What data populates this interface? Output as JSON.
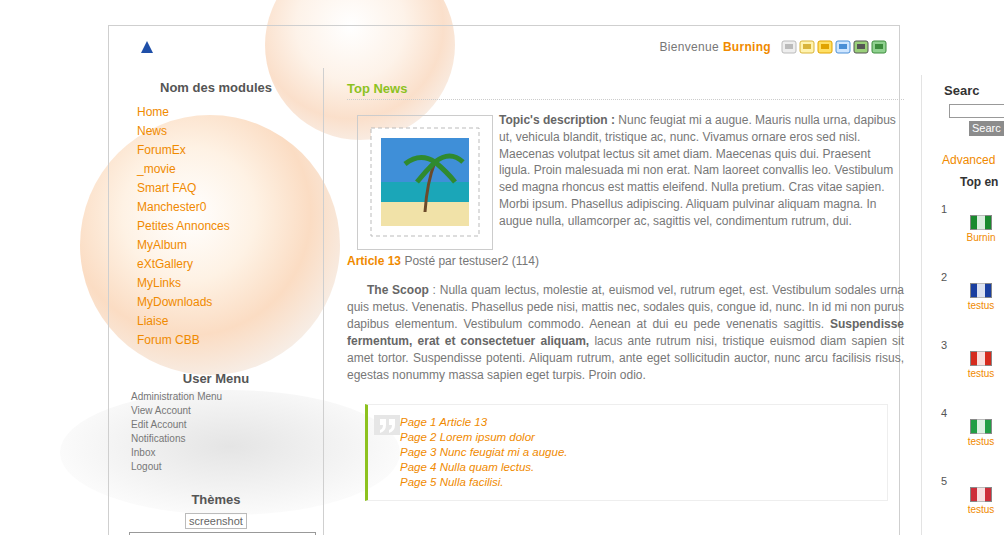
{
  "header": {
    "welcome": "Bienvenue",
    "user": "Burning"
  },
  "sidebar": {
    "modules_title": "Nom des modules",
    "modules": [
      "Home",
      "News",
      "ForumEx",
      "_movie",
      "Smart FAQ",
      "Manchester0",
      "Petites Annonces",
      "MyAlbum",
      "eXtGallery",
      "MyLinks",
      "MyDownloads",
      "Liaise",
      "Forum CBB"
    ],
    "user_menu_title": "User Menu",
    "user_menu": [
      "Administration Menu",
      "View Account",
      "Edit Account",
      "Notifications",
      "Inbox",
      "Logout"
    ],
    "themes_title": "Thèmes",
    "theme_preview": "screenshot"
  },
  "content": {
    "title": "Top News",
    "description_label": "Topic's description :",
    "description": "Nunc feugiat mi a augue. Mauris nulla urna, dapibus ut, vehicula blandit, tristique ac, nunc. Vivamus ornare eros sed nisl. Maecenas volutpat lectus sit amet diam. Maecenas quis dui. Praesent ligula. Proin malesuada mi non erat. Nam laoreet convallis leo. Vestibulum sed magna rhoncus est mattis eleifend. Nulla pretium. Cras vitae sapien. Morbi ipsum. Phasellus adipiscing. Aliquam pulvinar aliquam magna. In augue nulla, ullamcorper ac, sagittis vel, condimentum rutrum, dui.",
    "article_title": "Article 13",
    "posted_by": "Posté par testuser2 (114)",
    "scoop_label": "The Scoop",
    "scoop_before": ": Nulla quam lectus, molestie at, euismod vel, rutrum eget, est. Vestibulum sodales urna quis metus. Venenatis. Phasellus pede nisi, mattis nec, sodales quis, congue id, nunc. In id mi non purus dapibus elementum. Vestibulum commodo. Aenean at dui eu pede venenatis sagittis.",
    "scoop_bold": "Suspendisse fermentum, erat et consectetuer aliquam,",
    "scoop_after": "lacus ante rutrum nisi, tristique euismod diam sapien sit amet tortor. Suspendisse potenti. Aliquam rutrum, ante eget sollicitudin auctor, nunc arcu facilisis risus, egestas nonummy massa sapien eget turpis. Proin odio.",
    "pages": [
      "Page 1 Article 13",
      "Page 2 Lorem ipsum dolor",
      "Page 3 Nunc feugiat mi a augue.",
      "Page 4 Nulla quam lectus.",
      "Page 5 Nulla facilisi."
    ]
  },
  "right": {
    "search_title": "Searc",
    "search_button": "Searc",
    "advanced": "Advanced",
    "top_title": "Top en",
    "top_users": [
      {
        "rank": "1",
        "name": "Burnin",
        "color": "#1a8a2e"
      },
      {
        "rank": "2",
        "name": "testus",
        "color": "#1a3fa0"
      },
      {
        "rank": "3",
        "name": "testus",
        "color": "#d52b1e"
      },
      {
        "rank": "4",
        "name": "testus",
        "color": "#229e45"
      },
      {
        "rank": "5",
        "name": "testus",
        "color": "#cd2e3a"
      }
    ]
  }
}
